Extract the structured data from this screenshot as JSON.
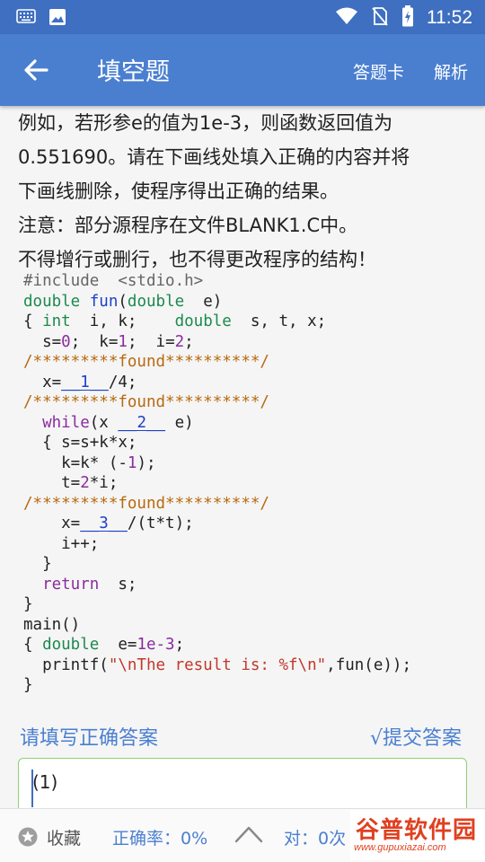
{
  "status_bar": {
    "time": "11:52",
    "icons": [
      "keyboard-icon",
      "image-icon",
      "wifi-icon",
      "no-sim-icon",
      "battery-charging-icon"
    ]
  },
  "app_bar": {
    "title": "填空题",
    "actions": {
      "answer_card": "答题卡",
      "analysis": "解析"
    }
  },
  "question": {
    "lines": [
      "例如，若形参e的值为1e-3，则函数返回值为",
      "0.551690。请在下画线处填入正确的内容并将",
      "下画线删除，使程序得出正确的结果。",
      "注意：部分源程序在文件BLANK1.C中。",
      "不得增行或删行，也不得更改程序的结构！"
    ]
  },
  "code": {
    "l1_include": "#include  <stdio.h>",
    "l2_type": "double",
    "l2_fn": "fun",
    "l2_open": "(",
    "l2_type2": "double",
    "l2_rest": "  e)",
    "l3_brace": "{ ",
    "l3_int": "int",
    "l3_mid": "  i, k;    ",
    "l3_double": "double",
    "l3_rest": "  s, t, x;",
    "l4_a": "  s=",
    "l4_n0": "0",
    "l4_b": ";  k=",
    "l4_n1": "1",
    "l4_c": ";  i=",
    "l4_n2": "2",
    "l4_d": ";",
    "found_comment": "/*********found**********/",
    "l6_a": "  x=",
    "blank1": "__1__",
    "l6_b": "/4;",
    "l8_while": "while",
    "l8_a": "(x ",
    "blank2": "__2__",
    "l8_b": " e)",
    "l9": "  { s=s+k*x;",
    "l10_a": "    k=k* (-",
    "l10_n": "1",
    "l10_b": ");",
    "l11_a": "    t=",
    "l11_n": "2",
    "l11_b": "*i;",
    "l13_a": "    x=",
    "blank3": "__3__",
    "l13_b": "/(t*t);",
    "l14": "    i++;",
    "l15": "  }",
    "l16_return": "return",
    "l16_rest": "  s;",
    "l17": "}",
    "l18": "main()",
    "l19_brace": "{ ",
    "l19_double": "double",
    "l19_a": "  e=",
    "l19_n": "1e-3",
    "l19_b": ";",
    "l20_a": "  printf(",
    "l20_str": "\"\\nThe result is: %f\\n\"",
    "l20_b": ",fun(e));",
    "l21": "}"
  },
  "answer": {
    "prompt": "请填写正确答案",
    "submit_label": "√提交答案",
    "input_value": "(1)"
  },
  "bottom_bar": {
    "favorite_label": "收藏",
    "accuracy_label": "正确率：0%",
    "correct_label": "对：0次"
  },
  "watermark": {
    "name": "谷普软件园",
    "url": "www.gupuxiazai.com"
  },
  "colors": {
    "app_bar": "#4a7fd0",
    "status_bar": "#3f6fc0",
    "accent": "#4a7fd0",
    "input_border": "#8fd16f"
  }
}
